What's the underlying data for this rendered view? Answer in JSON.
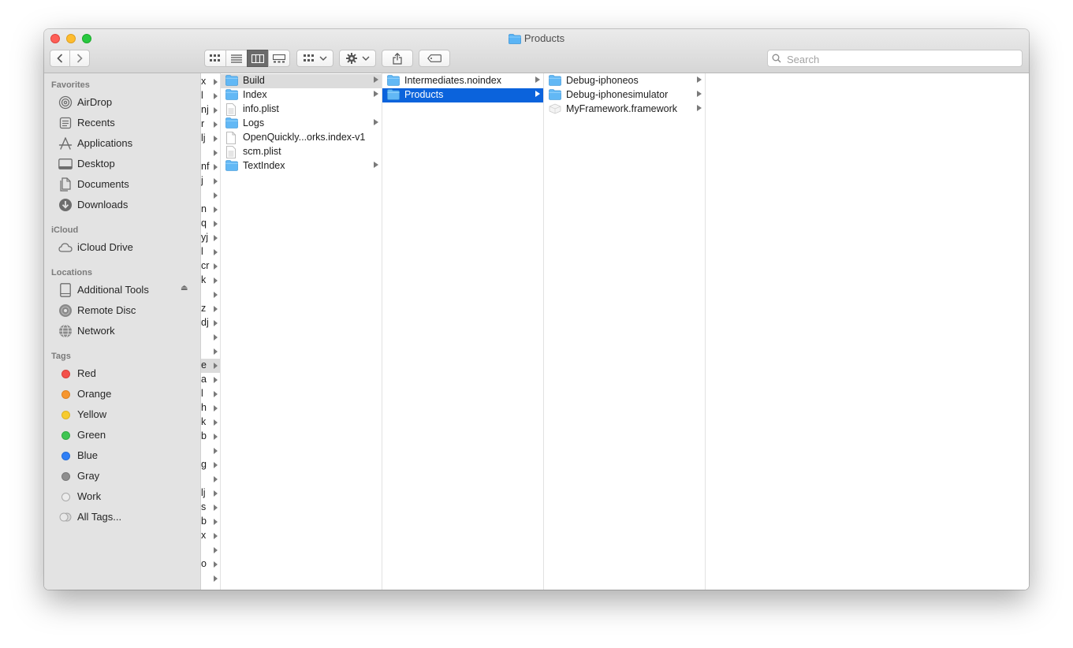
{
  "window": {
    "title": "Products"
  },
  "toolbar": {
    "back_icon": "chevron-left-icon",
    "forward_icon": "chevron-right-icon",
    "view_modes": [
      "icon-view-icon",
      "list-view-icon",
      "column-view-icon",
      "gallery-view-icon"
    ],
    "active_view": "column-view",
    "group_icon": "group-by-icon",
    "action_icon": "gear-icon",
    "share_icon": "share-icon",
    "tag_icon": "tag-icon",
    "search_placeholder": "Search"
  },
  "sidebar": {
    "favorites_title": "Favorites",
    "favorites": [
      {
        "label": "AirDrop",
        "icon": "airdrop-icon"
      },
      {
        "label": "Recents",
        "icon": "recents-icon"
      },
      {
        "label": "Applications",
        "icon": "applications-icon"
      },
      {
        "label": "Desktop",
        "icon": "desktop-icon"
      },
      {
        "label": "Documents",
        "icon": "documents-icon"
      },
      {
        "label": "Downloads",
        "icon": "downloads-icon"
      }
    ],
    "icloud_title": "iCloud",
    "icloud": [
      {
        "label": "iCloud Drive",
        "icon": "cloud-icon"
      }
    ],
    "locations_title": "Locations",
    "locations": [
      {
        "label": "Additional Tools",
        "icon": "disk-icon",
        "eject": "⏏"
      },
      {
        "label": "Remote Disc",
        "icon": "disc-icon"
      },
      {
        "label": "Network",
        "icon": "network-icon"
      }
    ],
    "tags_title": "Tags",
    "tags": [
      {
        "label": "Red",
        "color": "#f3504a"
      },
      {
        "label": "Orange",
        "color": "#f6962f"
      },
      {
        "label": "Yellow",
        "color": "#f7cb2f"
      },
      {
        "label": "Green",
        "color": "#3fc552"
      },
      {
        "label": "Blue",
        "color": "#2f7ff6"
      },
      {
        "label": "Gray",
        "color": "#8e8e8e"
      },
      {
        "label": "Work",
        "color": "none"
      },
      {
        "label": "All Tags...",
        "color": "all"
      }
    ]
  },
  "columns": {
    "narrow_fragments": [
      "x",
      "l",
      "nj",
      "r",
      "lj",
      "",
      "nf",
      "j",
      "",
      "n",
      "q",
      "yj",
      "l",
      "cr",
      "k",
      "",
      "z",
      "dj",
      "",
      "",
      "e",
      "a",
      "l",
      "h",
      "k",
      "b",
      "",
      "g",
      "",
      "lj",
      "s",
      "b",
      "x",
      "",
      "o",
      ""
    ],
    "narrow_selected_index": 20,
    "col1": [
      {
        "name": "Build",
        "type": "folder",
        "has_children": true,
        "selected": "gray"
      },
      {
        "name": "Index",
        "type": "folder",
        "has_children": true
      },
      {
        "name": "info.plist",
        "type": "plist"
      },
      {
        "name": "Logs",
        "type": "folder",
        "has_children": true
      },
      {
        "name": "OpenQuickly...orks.index-v1",
        "type": "file"
      },
      {
        "name": "scm.plist",
        "type": "plist"
      },
      {
        "name": "TextIndex",
        "type": "folder",
        "has_children": true
      }
    ],
    "col2": [
      {
        "name": "Intermediates.noindex",
        "type": "folder",
        "has_children": true
      },
      {
        "name": "Products",
        "type": "folder",
        "has_children": true,
        "selected": "blue"
      }
    ],
    "col3": [
      {
        "name": "Debug-iphoneos",
        "type": "folder",
        "has_children": true
      },
      {
        "name": "Debug-iphonesimulator",
        "type": "folder",
        "has_children": true
      },
      {
        "name": "MyFramework.framework",
        "type": "framework",
        "has_children": true
      }
    ]
  }
}
